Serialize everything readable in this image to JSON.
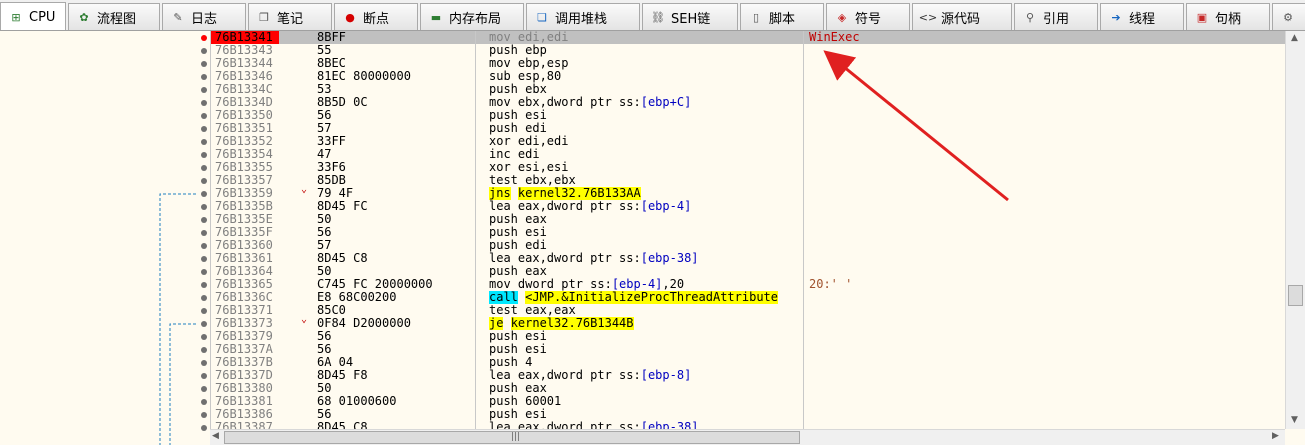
{
  "tabs": [
    {
      "label": "CPU",
      "icon": "cpu-icon",
      "glyph": "⊞",
      "color": "#2e7d32",
      "width": 66,
      "active": true
    },
    {
      "label": "流程图",
      "icon": "flowchart-icon",
      "glyph": "✿",
      "color": "#2e7d32",
      "width": 92
    },
    {
      "label": "日志",
      "icon": "log-icon",
      "glyph": "✎",
      "color": "#555",
      "width": 84
    },
    {
      "label": "笔记",
      "icon": "notes-icon",
      "glyph": "❐",
      "color": "#555",
      "width": 84
    },
    {
      "label": "断点",
      "icon": "breakpoint-icon",
      "glyph": "●",
      "color": "#d50000",
      "width": 84
    },
    {
      "label": "内存布局",
      "icon": "memory-map-icon",
      "glyph": "▬",
      "color": "#2e7d32",
      "width": 104
    },
    {
      "label": "调用堆栈",
      "icon": "call-stack-icon",
      "glyph": "❏",
      "color": "#1565c0",
      "width": 114
    },
    {
      "label": "SEH链",
      "icon": "seh-chain-icon",
      "glyph": "⛓",
      "color": "#555",
      "width": 96
    },
    {
      "label": "脚本",
      "icon": "script-icon",
      "glyph": "▯",
      "color": "#555",
      "width": 84
    },
    {
      "label": "符号",
      "icon": "symbols-icon",
      "glyph": "◈",
      "color": "#c62828",
      "width": 84
    },
    {
      "label": "源代码",
      "icon": "source-code-icon",
      "glyph": "<>",
      "color": "#333",
      "width": 100
    },
    {
      "label": "引用",
      "icon": "references-icon",
      "glyph": "⚲",
      "color": "#555",
      "width": 84
    },
    {
      "label": "线程",
      "icon": "threads-icon",
      "glyph": "➔",
      "color": "#1565c0",
      "width": 84
    },
    {
      "label": "句柄",
      "icon": "handles-icon",
      "glyph": "▣",
      "color": "#c62828",
      "width": 84
    },
    {
      "label": "",
      "icon": "overflow-icon",
      "glyph": "⚙",
      "color": "#555",
      "width": 40
    }
  ],
  "rows": [
    {
      "addr": "76B13341",
      "bytes": "8BFF",
      "asm": [
        [
          "mov edi,edi",
          ""
        ]
      ],
      "comment": "WinExec",
      "bp": true,
      "selected": true
    },
    {
      "addr": "76B13343",
      "bytes": "55",
      "asm": [
        [
          "push ebp",
          ""
        ]
      ]
    },
    {
      "addr": "76B13344",
      "bytes": "8BEC",
      "asm": [
        [
          "mov ebp,esp",
          ""
        ]
      ]
    },
    {
      "addr": "76B13346",
      "bytes": "81EC 80000000",
      "asm": [
        [
          "sub esp,80",
          ""
        ]
      ]
    },
    {
      "addr": "76B1334C",
      "bytes": "53",
      "asm": [
        [
          "push ebx",
          ""
        ]
      ]
    },
    {
      "addr": "76B1334D",
      "bytes": "8B5D 0C",
      "asm": [
        [
          "mov ebx,dword ptr ss:",
          ""
        ],
        [
          "[ebp+C]",
          "b"
        ]
      ]
    },
    {
      "addr": "76B13350",
      "bytes": "56",
      "asm": [
        [
          "push esi",
          ""
        ]
      ]
    },
    {
      "addr": "76B13351",
      "bytes": "57",
      "asm": [
        [
          "push edi",
          ""
        ]
      ]
    },
    {
      "addr": "76B13352",
      "bytes": "33FF",
      "asm": [
        [
          "xor edi,edi",
          ""
        ]
      ]
    },
    {
      "addr": "76B13354",
      "bytes": "47",
      "asm": [
        [
          "inc edi",
          ""
        ]
      ]
    },
    {
      "addr": "76B13355",
      "bytes": "33F6",
      "asm": [
        [
          "xor esi,esi",
          ""
        ]
      ]
    },
    {
      "addr": "76B13357",
      "bytes": "85DB",
      "asm": [
        [
          "test ebx,ebx",
          ""
        ]
      ]
    },
    {
      "addr": "76B13359",
      "bytes": "79 4F",
      "asm": [
        [
          "jns",
          "y"
        ],
        [
          " ",
          ""
        ],
        [
          "kernel32.76B133AA",
          "y"
        ]
      ],
      "jmp": true
    },
    {
      "addr": "76B1335B",
      "bytes": "8D45 FC",
      "asm": [
        [
          "lea eax,dword ptr ss:",
          ""
        ],
        [
          "[ebp-4]",
          "b"
        ]
      ]
    },
    {
      "addr": "76B1335E",
      "bytes": "50",
      "asm": [
        [
          "push eax",
          ""
        ]
      ]
    },
    {
      "addr": "76B1335F",
      "bytes": "56",
      "asm": [
        [
          "push esi",
          ""
        ]
      ]
    },
    {
      "addr": "76B13360",
      "bytes": "57",
      "asm": [
        [
          "push edi",
          ""
        ]
      ]
    },
    {
      "addr": "76B13361",
      "bytes": "8D45 C8",
      "asm": [
        [
          "lea eax,dword ptr ss:",
          ""
        ],
        [
          "[ebp-38]",
          "b"
        ]
      ]
    },
    {
      "addr": "76B13364",
      "bytes": "50",
      "asm": [
        [
          "push eax",
          ""
        ]
      ]
    },
    {
      "addr": "76B13365",
      "bytes": "C745 FC 20000000",
      "asm": [
        [
          "mov dword ptr ss:",
          ""
        ],
        [
          "[ebp-4]",
          "b"
        ],
        [
          ",20",
          ""
        ]
      ],
      "comment": "20:' '"
    },
    {
      "addr": "76B1336C",
      "bytes": "E8 68C00200",
      "asm": [
        [
          "call",
          "c"
        ],
        [
          " ",
          ""
        ],
        [
          "<JMP.&InitializeProcThreadAttribute",
          "y"
        ]
      ]
    },
    {
      "addr": "76B13371",
      "bytes": "85C0",
      "asm": [
        [
          "test eax,eax",
          ""
        ]
      ]
    },
    {
      "addr": "76B13373",
      "bytes": "0F84 D2000000",
      "asm": [
        [
          "je",
          "y"
        ],
        [
          " ",
          ""
        ],
        [
          "kernel32.76B1344B",
          "y"
        ]
      ],
      "jmp": true
    },
    {
      "addr": "76B13379",
      "bytes": "56",
      "asm": [
        [
          "push esi",
          ""
        ]
      ]
    },
    {
      "addr": "76B1337A",
      "bytes": "56",
      "asm": [
        [
          "push esi",
          ""
        ]
      ]
    },
    {
      "addr": "76B1337B",
      "bytes": "6A 04",
      "asm": [
        [
          "push 4",
          ""
        ]
      ]
    },
    {
      "addr": "76B1337D",
      "bytes": "8D45 F8",
      "asm": [
        [
          "lea eax,dword ptr ss:",
          ""
        ],
        [
          "[ebp-8]",
          "b"
        ]
      ]
    },
    {
      "addr": "76B13380",
      "bytes": "50",
      "asm": [
        [
          "push eax",
          ""
        ]
      ]
    },
    {
      "addr": "76B13381",
      "bytes": "68 01000600",
      "asm": [
        [
          "push 60001",
          ""
        ]
      ]
    },
    {
      "addr": "76B13386",
      "bytes": "56",
      "asm": [
        [
          "push esi",
          ""
        ]
      ]
    },
    {
      "addr": "76B13387",
      "bytes": "8D45 C8",
      "asm": [
        [
          "lea eax,dword ptr ss:",
          ""
        ],
        [
          "[ebp-38]",
          "b"
        ]
      ]
    }
  ],
  "scroll": {
    "up": "▲",
    "down": "▼",
    "left": "◀",
    "right": "▶",
    "grip": "|||"
  },
  "colors": {
    "breakpoint": "#ff0000",
    "highlight": "#ffff00",
    "call_highlight": "#00e8ff",
    "annotation_arrow": "#e02020",
    "jump_line": "#2080c0"
  }
}
